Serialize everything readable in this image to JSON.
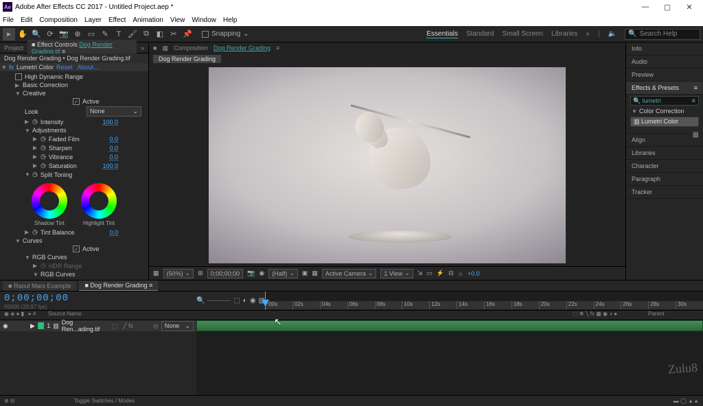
{
  "title": "Adobe After Effects CC 2017 - Untitled Project.aep *",
  "menu": [
    "File",
    "Edit",
    "Composition",
    "Layer",
    "Effect",
    "Animation",
    "View",
    "Window",
    "Help"
  ],
  "workspaces": [
    "Essentials",
    "Standard",
    "Small Screen",
    "Libraries"
  ],
  "searchHelp": "Search Help",
  "snapping": "Snapping",
  "leftTabs": {
    "project": "Project",
    "effectControls": "Effect Controls",
    "layerLink": "Dog Render Grading.tif"
  },
  "effectHeader": "Dog Render Grading • Dog Render Grading.tif",
  "effectName": "Lumetri Color",
  "reset": "Reset",
  "about": "About...",
  "hdr": "High Dynamic Range",
  "sections": {
    "basic": "Basic Correction",
    "creative": "Creative",
    "look": "Look",
    "lookVal": "None",
    "intensity": "Intensity",
    "intensityVal": "100.0",
    "adjustments": "Adjustments",
    "fadedFilm": "Faded Film",
    "fadedFilmVal": "0.0",
    "sharpen": "Sharpen",
    "sharpenVal": "0.0",
    "vibrance": "Vibrance",
    "vibranceVal": "0.0",
    "saturation": "Saturation",
    "saturationVal": "100.0",
    "splitToning": "Split Toning",
    "shadowTint": "Shadow Tint",
    "highlightTint": "Highlight Tint",
    "tintBalance": "Tint Balance",
    "tintBalanceVal": "0.0",
    "curves": "Curves",
    "active": "Active",
    "rgbCurves": "RGB Curves",
    "hdrRange": "HDR Range"
  },
  "viewer": {
    "tabLabel": "Composition",
    "compLink": "Dog Render Grading",
    "compTab": "Dog Render Grading",
    "zoom": "(50%)",
    "time": "0;00;00;00",
    "res": "(Half)",
    "camera": "Active Camera",
    "views": "1 View",
    "exposure": "+0.0"
  },
  "right": {
    "info": "Info",
    "audio": "Audio",
    "preview": "Preview",
    "effectsPresets": "Effects & Presets",
    "searchVal": "lumetri",
    "colorCorrection": "Color Correction",
    "lumetriColor": "Lumetri Color",
    "align": "Align",
    "libraries": "Libraries",
    "character": "Character",
    "paragraph": "Paragraph",
    "tracker": "Tracker"
  },
  "timeline": {
    "tab1": "Raoul Marx Example",
    "tab2": "Dog Render Grading",
    "timecode": "0;00;00;00",
    "fps": "00000 (29.97 fps)",
    "colSource": "Source Name",
    "colParent": "Parent",
    "layerNum": "1",
    "layerName": "Dog Ren...ading.tif",
    "parentVal": "None",
    "ticks": [
      ":00s",
      "02s",
      "04s",
      "06s",
      "08s",
      "10s",
      "12s",
      "14s",
      "16s",
      "18s",
      "20s",
      "22s",
      "24s",
      "26s",
      "28s",
      "30s"
    ],
    "footer": "Toggle Switches / Modes"
  },
  "signature": "Zulu8"
}
